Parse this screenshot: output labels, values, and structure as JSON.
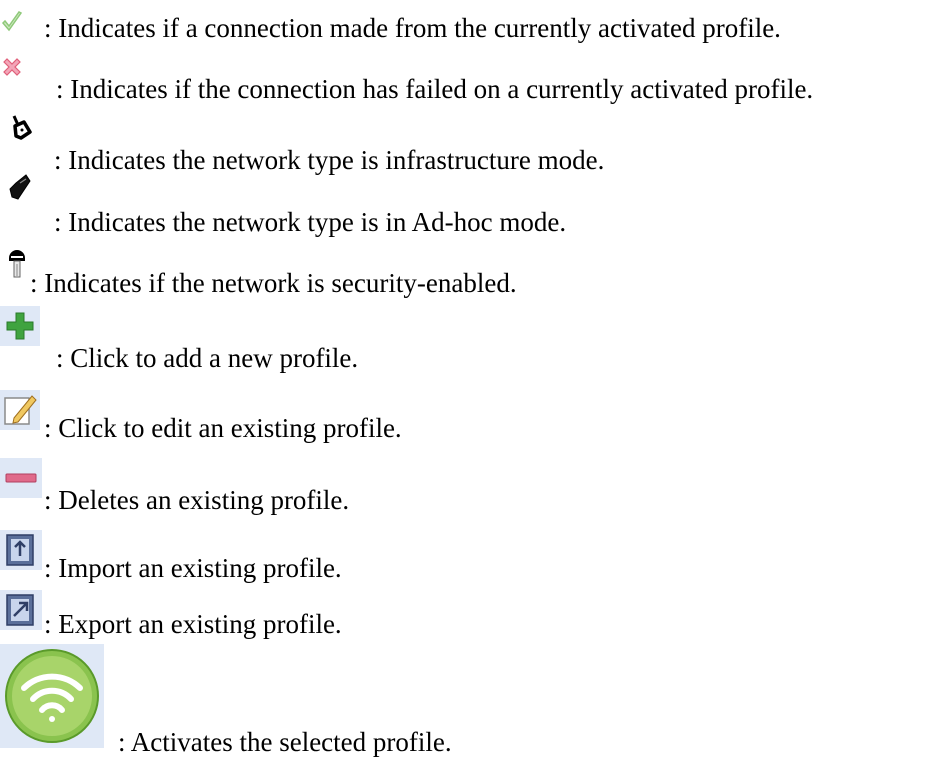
{
  "legend": [
    {
      "icon": "green-check-icon",
      "text": ": Indicates if a connection made from the currently activated profile."
    },
    {
      "icon": "red-x-icon",
      "text": ": Indicates if the connection has failed on a currently activated profile."
    },
    {
      "icon": "infrastructure-mode-icon",
      "text": ": Indicates the network type is infrastructure mode."
    },
    {
      "icon": "ad-hoc-mode-icon",
      "text": ": Indicates the network type is in Ad-hoc mode."
    },
    {
      "icon": "security-key-icon",
      "text": ": Indicates if the network is security-enabled."
    },
    {
      "icon": "add-profile-icon",
      "text": ": Click to add a new profile."
    },
    {
      "icon": "edit-profile-icon",
      "text": ": Click to edit an existing profile."
    },
    {
      "icon": "delete-profile-icon",
      "text": ": Deletes an existing profile."
    },
    {
      "icon": "import-profile-icon",
      "text": ": Import an existing profile."
    },
    {
      "icon": "export-profile-icon",
      "text": ": Export an existing profile."
    },
    {
      "icon": "activate-profile-icon",
      "text": ": Activates the selected profile."
    }
  ],
  "colors": {
    "check": "#8fc97a",
    "x": "#e0607a",
    "add": "#3fa33f",
    "delete": "#e06a8a",
    "button_bg": "#dfe8f6",
    "wifi_green": "#8ac34e"
  }
}
